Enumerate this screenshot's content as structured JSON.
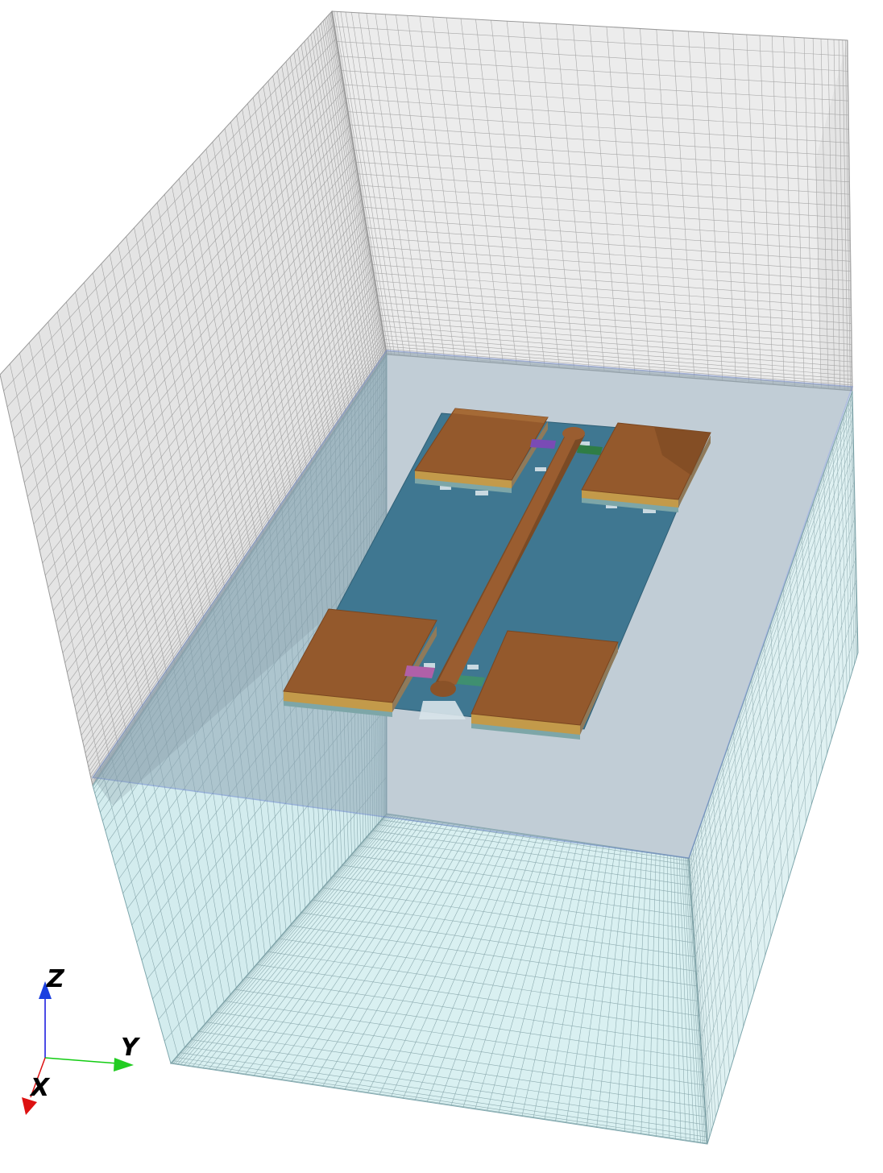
{
  "view": {
    "background": "#ffffff",
    "air_box_color": "#e6e6e6",
    "substrate_box_color": "#cfecef",
    "mesh_line_color": "#8a8a8a",
    "dielectric_sheet_color": "#a9b9c4",
    "board_color": "#3f7791",
    "metal_color": "#9a5d30",
    "port_colors": [
      "#7a4bb5",
      "#2f7d45",
      "#b060a8",
      "#3f8f70"
    ]
  },
  "axes": {
    "z": {
      "label": "Z",
      "color": "#1111dd"
    },
    "y": {
      "label": "Y",
      "color": "#11cc11"
    },
    "x": {
      "label": "X",
      "color": "#dd1111"
    }
  },
  "model": {
    "pads": [
      "pad-top-left",
      "pad-top-right",
      "pad-bottom-left",
      "pad-bottom-right"
    ],
    "ports": [
      "port-top-left",
      "port-top-right",
      "port-bottom-left",
      "port-bottom-right"
    ]
  }
}
